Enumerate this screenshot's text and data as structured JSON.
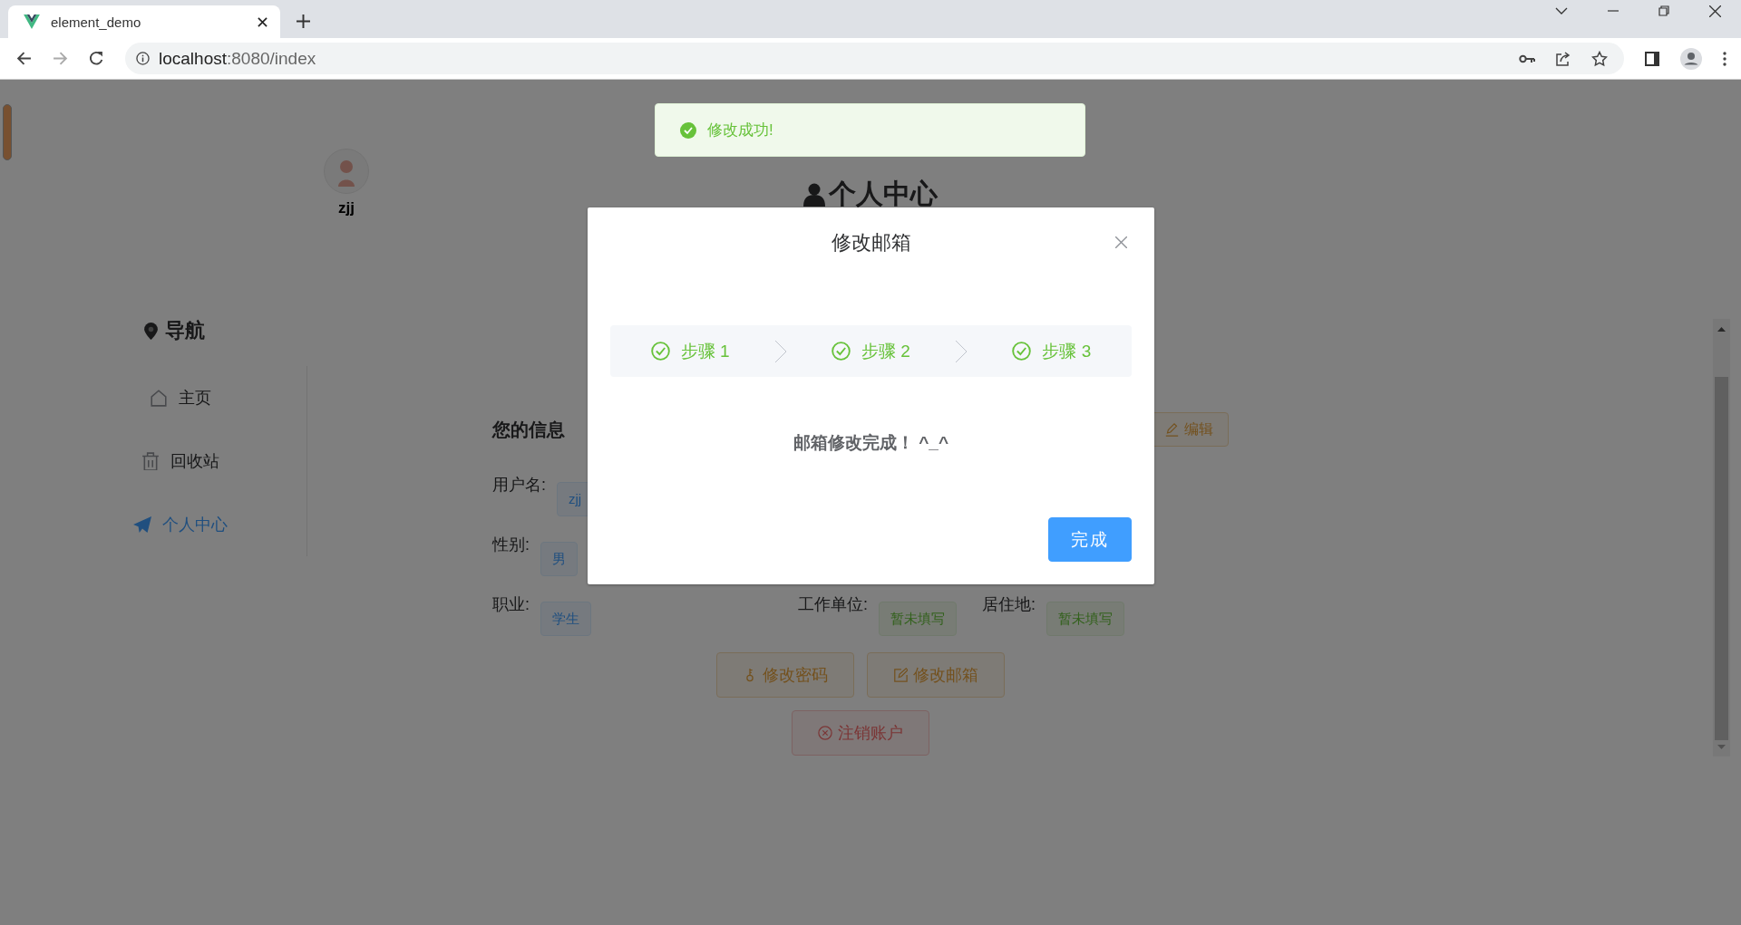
{
  "browser": {
    "tab_title": "element_demo",
    "url_host": "localhost",
    "url_path": ":8080/index"
  },
  "header": {
    "user_name": "zjj",
    "title": "个人中心"
  },
  "nav": {
    "title": "导航",
    "items": [
      {
        "label": "主页",
        "kind": "home",
        "selected": false
      },
      {
        "label": "回收站",
        "kind": "trash",
        "selected": false
      },
      {
        "label": "个人中心",
        "kind": "plane",
        "selected": true
      }
    ]
  },
  "info": {
    "title": "您的信息",
    "edit_button": "编辑",
    "rows": [
      {
        "cells": [
          {
            "label": "用户名:",
            "value": "zjj",
            "kind": "info"
          }
        ]
      },
      {
        "cells": [
          {
            "label": "性别:",
            "value": "男",
            "kind": "info"
          }
        ]
      },
      {
        "cells": [
          {
            "label": "职业:",
            "value": "学生",
            "kind": "info"
          },
          {
            "label": "工作单位:",
            "value": "暂未填写",
            "kind": "success"
          },
          {
            "label": "居住地:",
            "value": "暂未填写",
            "kind": "success"
          }
        ]
      }
    ]
  },
  "actions": [
    {
      "label": "修改密码",
      "kind": "key"
    },
    {
      "label": "修改邮箱",
      "kind": "edit"
    },
    {
      "label": "注销账户",
      "kind": "delete"
    }
  ],
  "toast": {
    "kind": "success",
    "text": "修改成功!"
  },
  "dialog": {
    "title": "修改邮箱",
    "steps": [
      {
        "label": "步骤 1",
        "kind": "success"
      },
      {
        "label": "步骤 2",
        "kind": "success"
      },
      {
        "label": "步骤 3",
        "kind": "success"
      }
    ],
    "message": "邮箱修改完成！ ^_^",
    "confirm_button": "完成"
  }
}
